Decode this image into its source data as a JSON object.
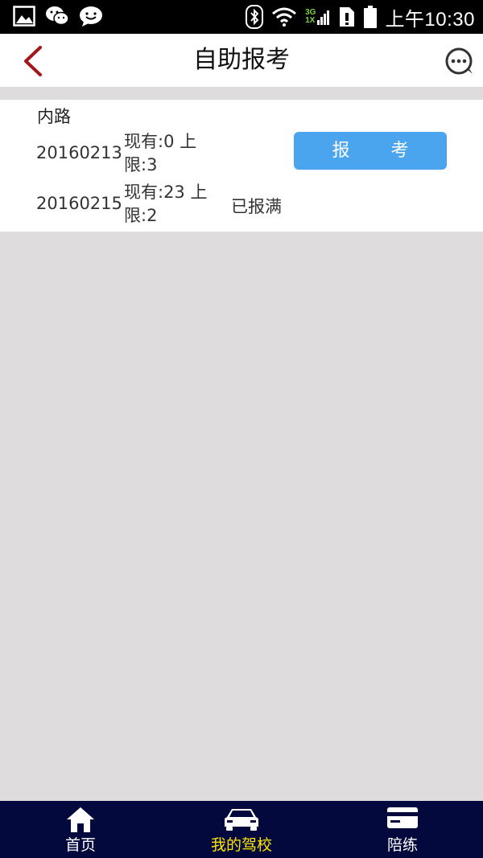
{
  "status_bar": {
    "net_top": "3G",
    "net_bottom": "1X",
    "time": "上午10:30"
  },
  "header": {
    "title": "自助报考"
  },
  "section": {
    "title": "内路",
    "rows": [
      {
        "date": "20160213",
        "quota": "现有:0 上限:3",
        "action_label": "报  考",
        "status": ""
      },
      {
        "date": "20160215",
        "quota": "现有:23 上限:2",
        "action_label": "",
        "status": "已报满"
      }
    ]
  },
  "bottom_nav": {
    "items": [
      {
        "label": "首页",
        "icon": "home-icon",
        "active": false
      },
      {
        "label": "我的驾校",
        "icon": "car-icon",
        "active": true
      },
      {
        "label": "陪练",
        "icon": "card-icon",
        "active": false
      }
    ],
    "active_color": "#ffe400"
  },
  "colors": {
    "accent": "#4aa5ee",
    "nav_bg": "#04093d",
    "back_arrow": "#a3161a"
  }
}
